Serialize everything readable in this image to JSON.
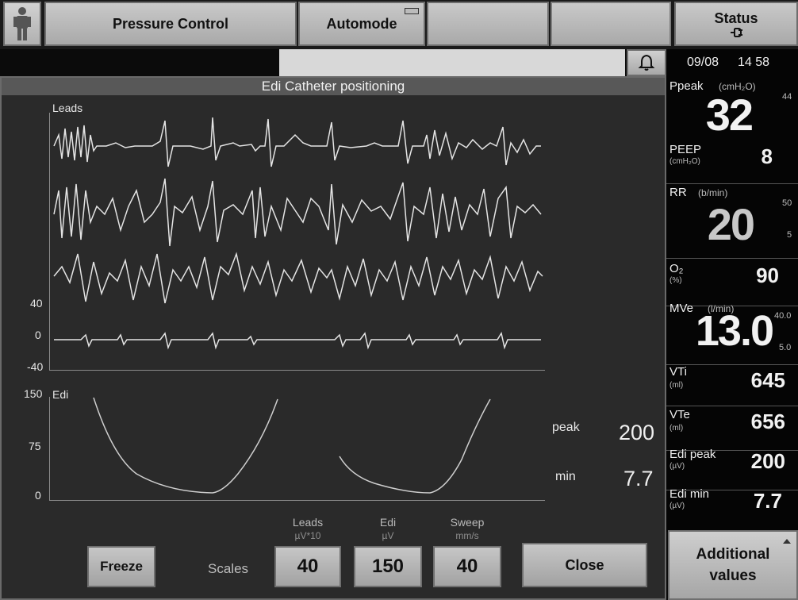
{
  "topbar": {
    "mode_label": "Pressure Control",
    "automode_label": "Automode",
    "status_label": "Status"
  },
  "dialog": {
    "title": "Edi Catheter positioning",
    "leads_label": "Leads",
    "leads_axis": {
      "top": "40",
      "mid": "0",
      "bottom": "-40"
    },
    "edi_label": "Edi",
    "edi_axis": {
      "top": "150",
      "mid": "75",
      "bottom": "0"
    },
    "peak_label": "peak",
    "peak_value": "200",
    "min_label": "min",
    "min_value": "7.7",
    "scales_label": "Scales",
    "scales": [
      {
        "head": "Leads",
        "unit": "µV*10",
        "value": "40"
      },
      {
        "head": "Edi",
        "unit": "µV",
        "value": "150"
      },
      {
        "head": "Sweep",
        "unit": "mm/s",
        "value": "40"
      }
    ],
    "freeze_label": "Freeze",
    "close_label": "Close"
  },
  "side": {
    "date": "09/08",
    "time": "14 58",
    "ppeak": {
      "label": "Ppeak",
      "unit": "(cmH₂O)",
      "value": "32",
      "limit_high": "44"
    },
    "peep": {
      "label": "PEEP",
      "unit": "(cmH₂O)",
      "value": "8"
    },
    "rr": {
      "label": "RR",
      "unit": "(b/min)",
      "value": "20",
      "limit_high": "50",
      "limit_low": "5"
    },
    "o2": {
      "label": "O₂",
      "unit": "(%)",
      "value": "90"
    },
    "mve": {
      "label": "MVe",
      "unit": "(l/min)",
      "value": "13.0",
      "limit_high": "40.0",
      "limit_low": "5.0"
    },
    "vti": {
      "label": "VTi",
      "unit": "(ml)",
      "value": "645"
    },
    "vte": {
      "label": "VTe",
      "unit": "(ml)",
      "value": "656"
    },
    "edi_peak": {
      "label": "Edi peak",
      "unit": "(µV)",
      "value": "200"
    },
    "edi_min": {
      "label": "Edi min",
      "unit": "(µV)",
      "value": "7.7"
    }
  },
  "additional": {
    "line1": "Additional",
    "line2": "values"
  }
}
